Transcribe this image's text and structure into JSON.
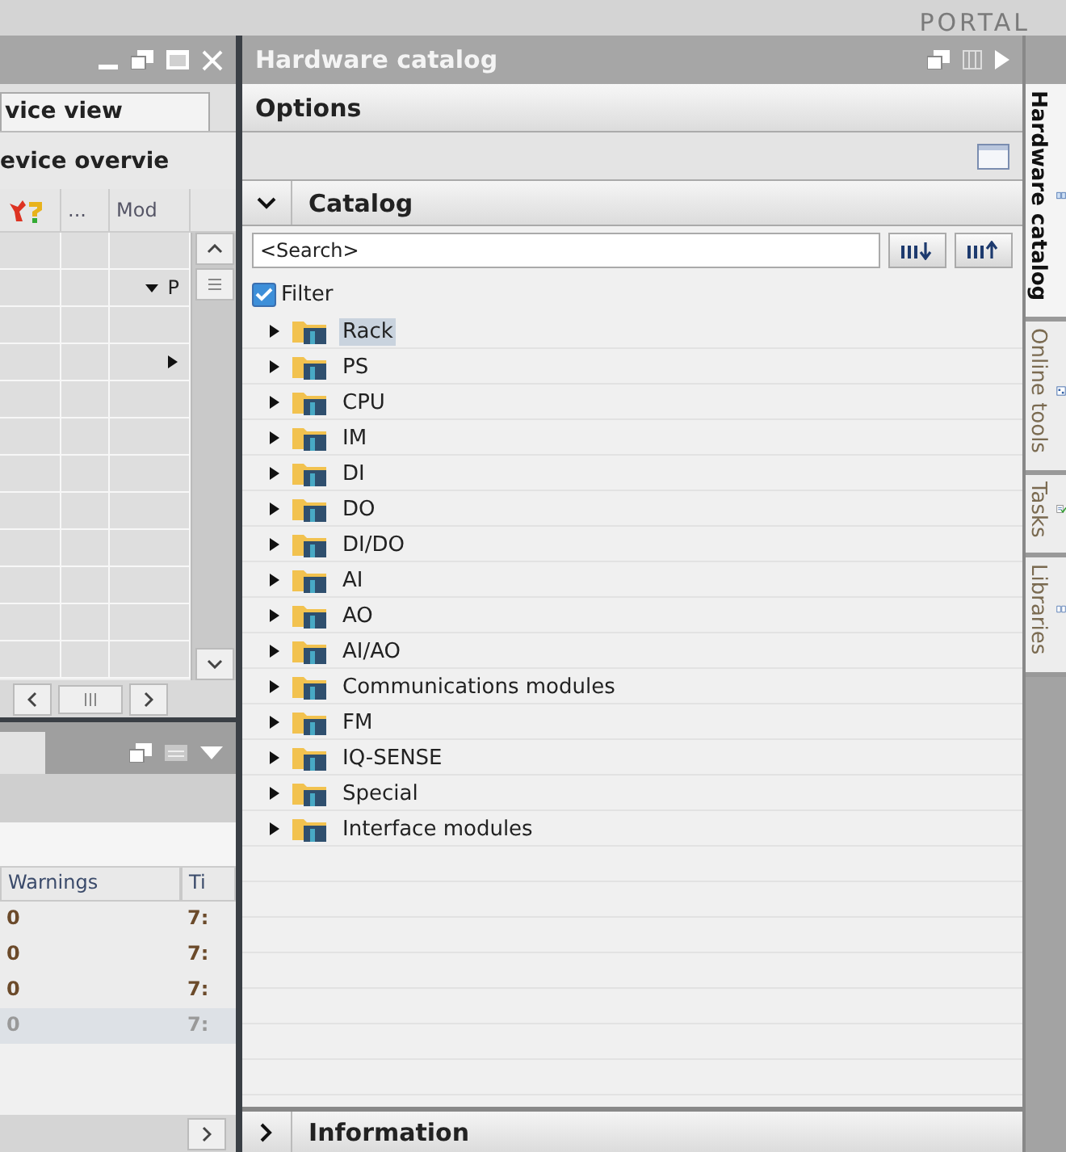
{
  "header": {
    "product": "PORTAL"
  },
  "editor": {
    "tab": "vice view",
    "section_title": "evice overvie",
    "columns": [
      "...",
      "Mod"
    ],
    "rows": [
      {
        "kind": "plain"
      },
      {
        "kind": "expanded",
        "label": "P"
      },
      {
        "kind": "plain"
      },
      {
        "kind": "collapsed"
      },
      {
        "kind": "plain"
      },
      {
        "kind": "plain"
      },
      {
        "kind": "plain"
      },
      {
        "kind": "plain"
      },
      {
        "kind": "plain"
      },
      {
        "kind": "plain"
      },
      {
        "kind": "plain"
      },
      {
        "kind": "plain"
      }
    ]
  },
  "inspector": {
    "columns": [
      "Warnings",
      "Ti"
    ],
    "rows": [
      {
        "warnings": "0",
        "time": "7:",
        "selected": false
      },
      {
        "warnings": "0",
        "time": "7:",
        "selected": false
      },
      {
        "warnings": "0",
        "time": "7:",
        "selected": false
      },
      {
        "warnings": "0",
        "time": "7:",
        "selected": true
      }
    ]
  },
  "catalog_panel": {
    "title": "Hardware catalog",
    "options": "Options",
    "catalog_title": "Catalog",
    "catalog_expanded": true,
    "search": {
      "placeholder": "<Search>"
    },
    "filter": {
      "label": "Filter",
      "checked": true
    },
    "items": [
      {
        "label": "Rack",
        "selected": true
      },
      {
        "label": "PS",
        "selected": false
      },
      {
        "label": "CPU",
        "selected": false
      },
      {
        "label": "IM",
        "selected": false
      },
      {
        "label": "DI",
        "selected": false
      },
      {
        "label": "DO",
        "selected": false
      },
      {
        "label": "DI/DO",
        "selected": false
      },
      {
        "label": "AI",
        "selected": false
      },
      {
        "label": "AO",
        "selected": false
      },
      {
        "label": "AI/AO",
        "selected": false
      },
      {
        "label": "Communications modules",
        "selected": false
      },
      {
        "label": "FM",
        "selected": false
      },
      {
        "label": "IQ-SENSE",
        "selected": false
      },
      {
        "label": "Special",
        "selected": false
      },
      {
        "label": "Interface modules",
        "selected": false
      }
    ],
    "information": {
      "label": "Information",
      "expanded": false
    }
  },
  "side_tabs": [
    {
      "label": "Hardware catalog",
      "selected": true
    },
    {
      "label": "Online tools",
      "selected": false
    },
    {
      "label": "Tasks",
      "selected": false
    },
    {
      "label": "Libraries",
      "selected": false
    }
  ]
}
